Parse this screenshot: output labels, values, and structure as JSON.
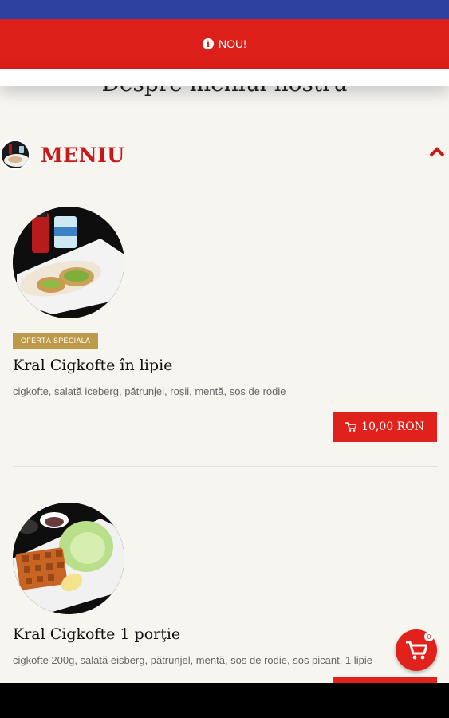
{
  "banner": {
    "label": "NOU!",
    "icon": "info-icon"
  },
  "about": {
    "title": "Despre meniul nostru"
  },
  "menu": {
    "title": "MENIU",
    "toggle_icon": "chevron-up-icon"
  },
  "products": [
    {
      "badge": "OFERTĂ SPECIALĂ",
      "name": "Kral Cigkofte în lipie",
      "description": "cigkofte, salată iceberg, pătrunjel, roșii, mentă, sos de rodie",
      "price": "10,00 RON"
    },
    {
      "name": "Kral Cigkofte 1 porţie",
      "description": "cigkofte 200g, salată eisberg, pătrunjel, mentă, sos de rodie, sos picant, 1 lipie"
    }
  ],
  "cart": {
    "count": "0",
    "icon": "cart-icon"
  },
  "colors": {
    "accent": "#e1211c",
    "badge": "#bd9a4a",
    "status_bar": "#2f41a0"
  }
}
